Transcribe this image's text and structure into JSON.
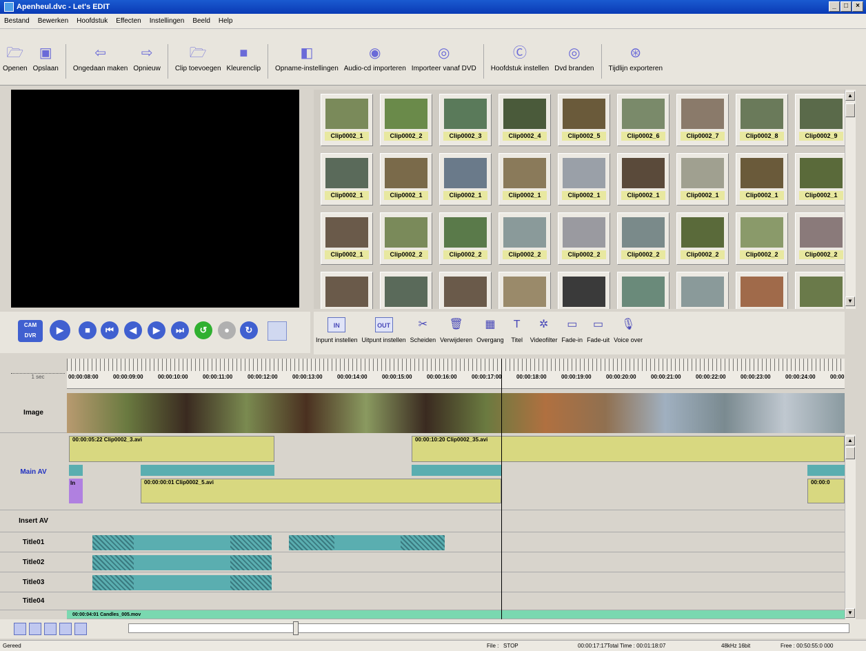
{
  "window": {
    "title": "Apenheul.dvc - Let's EDIT"
  },
  "menu": [
    "Bestand",
    "Bewerken",
    "Hoofdstuk",
    "Effecten",
    "Instellingen",
    "Beeld",
    "Help"
  ],
  "toolbar": [
    {
      "label": "Openen",
      "icon": "folder-open-icon"
    },
    {
      "label": "Opslaan",
      "icon": "save-icon"
    },
    {
      "label": "Ongedaan maken",
      "icon": "undo-icon"
    },
    {
      "label": "Opnieuw",
      "icon": "redo-icon"
    },
    {
      "label": "Clip toevoegen",
      "icon": "add-clip-icon"
    },
    {
      "label": "Kleurenclip",
      "icon": "color-clip-icon"
    },
    {
      "label": "Opname-instellingen",
      "icon": "capture-settings-icon"
    },
    {
      "label": "Audio-cd importeren",
      "icon": "audio-cd-icon"
    },
    {
      "label": "Importeer vanaf DVD",
      "icon": "dvd-import-icon"
    },
    {
      "label": "Hoofdstuk instellen",
      "icon": "chapter-icon"
    },
    {
      "label": "Dvd branden",
      "icon": "burn-dvd-icon"
    },
    {
      "label": "Tijdlijn exporteren",
      "icon": "export-timeline-icon"
    }
  ],
  "clips": [
    {
      "name": "Clip0002_1",
      "color": "#7a8a5a"
    },
    {
      "name": "Clip0002_2",
      "color": "#6a8a4a"
    },
    {
      "name": "Clip0002_3",
      "color": "#5a7a5a"
    },
    {
      "name": "Clip0002_4",
      "color": "#4a5a3a"
    },
    {
      "name": "Clip0002_5",
      "color": "#6a5a3a"
    },
    {
      "name": "Clip0002_6",
      "color": "#7a8a6a"
    },
    {
      "name": "Clip0002_7",
      "color": "#8a7a6a"
    },
    {
      "name": "Clip0002_8",
      "color": "#6a7a5a"
    },
    {
      "name": "Clip0002_9",
      "color": "#5a6a4a"
    },
    {
      "name": "Clip0002_1",
      "color": "#5a6a5a"
    },
    {
      "name": "Clip0002_1",
      "color": "#7a6a4a"
    },
    {
      "name": "Clip0002_1",
      "color": "#6a7a8a"
    },
    {
      "name": "Clip0002_1",
      "color": "#8a7a5a"
    },
    {
      "name": "Clip0002_1",
      "color": "#9aa0a8"
    },
    {
      "name": "Clip0002_1",
      "color": "#5a4a3a"
    },
    {
      "name": "Clip0002_1",
      "color": "#a0a090"
    },
    {
      "name": "Clip0002_1",
      "color": "#6a5a3a"
    },
    {
      "name": "Clip0002_1",
      "color": "#5a6a3a"
    },
    {
      "name": "Clip0002_1",
      "color": "#6a5a4a"
    },
    {
      "name": "Clip0002_2",
      "color": "#7a8a5a"
    },
    {
      "name": "Clip0002_2",
      "color": "#5a7a4a"
    },
    {
      "name": "Clip0002_2",
      "color": "#8a9a9a"
    },
    {
      "name": "Clip0002_2",
      "color": "#9a9aa0"
    },
    {
      "name": "Clip0002_2",
      "color": "#7a8a8a"
    },
    {
      "name": "Clip0002_2",
      "color": "#5a6a3a"
    },
    {
      "name": "Clip0002_2",
      "color": "#8a9a6a"
    },
    {
      "name": "Clip0002_2",
      "color": "#8a7a7a"
    },
    {
      "name": "",
      "color": "#6a5a4a"
    },
    {
      "name": "",
      "color": "#5a6a5a"
    },
    {
      "name": "",
      "color": "#6a5a4a"
    },
    {
      "name": "",
      "color": "#9a8a6a"
    },
    {
      "name": "",
      "color": "#3a3a3a"
    },
    {
      "name": "",
      "color": "#6a8a7a"
    },
    {
      "name": "",
      "color": "#8a9a9a"
    },
    {
      "name": "",
      "color": "#a06a4a"
    },
    {
      "name": "",
      "color": "#6a7a4a"
    }
  ],
  "transport": {
    "cam": "CAM",
    "dvr": "DVR"
  },
  "edit_tools": [
    {
      "label": "Inpunt instellen",
      "icon": "in-point-icon",
      "tag": "IN"
    },
    {
      "label": "Uitpunt instellen",
      "icon": "out-point-icon",
      "tag": "OUT"
    },
    {
      "label": "Scheiden",
      "icon": "split-icon",
      "tag": ""
    },
    {
      "label": "Verwijderen",
      "icon": "delete-icon",
      "tag": ""
    },
    {
      "label": "Overgang",
      "icon": "transition-icon",
      "tag": ""
    },
    {
      "label": "Titel",
      "icon": "title-icon",
      "tag": ""
    },
    {
      "label": "Videofilter",
      "icon": "video-filter-icon",
      "tag": ""
    },
    {
      "label": "Fade-in",
      "icon": "fade-in-icon",
      "tag": ""
    },
    {
      "label": "Fade-uit",
      "icon": "fade-out-icon",
      "tag": ""
    },
    {
      "label": "Voice over",
      "icon": "microphone-icon",
      "tag": ""
    }
  ],
  "ruler": {
    "scale_label": "1 sec",
    "ticks": [
      "00:00:08:00",
      "00:00:09:00",
      "00:00:10:00",
      "00:00:11:00",
      "00:00:12:00",
      "00:00:13:00",
      "00:00:14:00",
      "00:00:15:00",
      "00:00:16:00",
      "00:00:17:00",
      "00:00:18:00",
      "00:00:19:00",
      "00:00:20:00",
      "00:00:21:00",
      "00:00:22:00",
      "00:00:23:00",
      "00:00:24:00",
      "00:00:"
    ]
  },
  "tracks": {
    "image": "Image",
    "main_av": "Main AV",
    "insert_av": "Insert AV",
    "title1": "Title01",
    "title2": "Title02",
    "title3": "Title03",
    "title4": "Title04"
  },
  "timeline_clips": {
    "clip_a": "00:00:05:22   Clip0002_3.avi",
    "clip_b": "00:00:10:20   Clip0002_35.avi",
    "clip_c": "00:00:00:01   Clip0002_5.avi",
    "clip_d": "00:00:0",
    "in_marker": "In",
    "bottom_clip": "00:00:04:01     Candles_005.mov"
  },
  "status": {
    "left": "Gereed",
    "file_label": "File :",
    "state": "STOP",
    "time": "00:00:17:17",
    "total": "Total Time : 00:01:18:07",
    "audio": "48kHz 16bit",
    "free": "Free : 00:50:55:0 000"
  }
}
